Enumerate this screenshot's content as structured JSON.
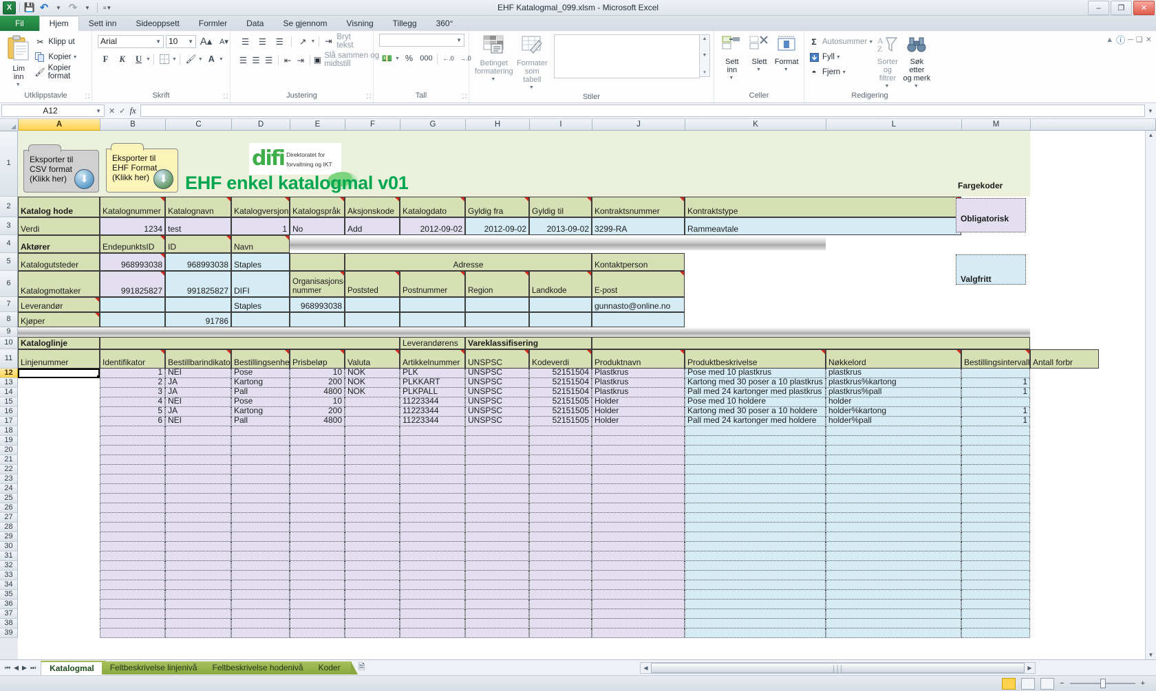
{
  "window": {
    "title": "EHF Katalogmal_099.xlsm  -  Microsoft Excel",
    "minimize": "–",
    "maximize": "❐",
    "close": "✕",
    "qat": {
      "excel": "X",
      "save": "save-icon",
      "undo": "undo-icon",
      "redo": "redo-icon",
      "customize": "customize-icon"
    }
  },
  "ribbon": {
    "tabs": [
      {
        "label": "Fil",
        "type": "file"
      },
      {
        "label": "Hjem",
        "type": "active"
      },
      {
        "label": "Sett inn",
        "type": "normal"
      },
      {
        "label": "Sideoppsett",
        "type": "normal"
      },
      {
        "label": "Formler",
        "type": "normal"
      },
      {
        "label": "Data",
        "type": "normal"
      },
      {
        "label": "Se gjennom",
        "type": "normal"
      },
      {
        "label": "Visning",
        "type": "normal"
      },
      {
        "label": "Tillegg",
        "type": "normal"
      },
      {
        "label": "360°",
        "type": "normal"
      }
    ],
    "groups": {
      "clipboard": {
        "name": "Utklippstavle",
        "paste": "Lim\ninn",
        "cut": "Klipp ut",
        "copy": "Kopier",
        "format_painter": "Kopier format"
      },
      "font": {
        "name": "Skrift",
        "font_name": "Arial",
        "font_size": "10",
        "grow": "A",
        "shrink": "A",
        "bold": "F",
        "italic": "K",
        "underline": "U",
        "borders": "borders-icon",
        "fill": "fill-color-icon",
        "fontcolor": "A"
      },
      "alignment": {
        "name": "Justering",
        "wrap": "Bryt tekst",
        "merge": "Slå sammen og midtstill",
        "orientation": "orientation-icon",
        "indent_dec": "decrease-indent-icon",
        "indent_inc": "increase-indent-icon"
      },
      "number": {
        "name": "Tall",
        "format_value": "",
        "currency": "currency-icon",
        "percent": "%",
        "comma": "000",
        "dec_inc": "increase-decimal-icon",
        "dec_dec": "decrease-decimal-icon"
      },
      "styles": {
        "name": "Stiler",
        "conditional": "Betinget\nformatering",
        "as_table": "Formater\nsom tabell"
      },
      "cells": {
        "name": "Celler",
        "insert": "Sett\ninn",
        "delete": "Slett",
        "format": "Format"
      },
      "editing": {
        "name": "Redigering",
        "autosum": "Autosummer",
        "fill": "Fyll",
        "clear": "Fjern",
        "sort_filter": "Sorter og\nfiltrer",
        "find_select": "Søk etter\nog merk"
      }
    }
  },
  "formula_bar": {
    "name_box": "A12",
    "formula": "",
    "fx": "fx"
  },
  "grid": {
    "columns": [
      "A",
      "B",
      "C",
      "D",
      "E",
      "F",
      "G",
      "H",
      "I",
      "J",
      "K",
      "L",
      "M"
    ],
    "selected_column": "A",
    "selected_row": "12",
    "rows": [
      "1",
      "2",
      "3",
      "4",
      "5",
      "6",
      "7",
      "8",
      "9",
      "10",
      "11",
      "12",
      "13",
      "14",
      "15",
      "16",
      "17",
      "18",
      "19",
      "20",
      "21",
      "22",
      "23",
      "24",
      "25",
      "26",
      "27",
      "28",
      "29",
      "30",
      "31",
      "32",
      "33",
      "34",
      "35",
      "36",
      "37",
      "38",
      "39"
    ],
    "sheet_title": "EHF enkel katalogmal v01",
    "logo": {
      "word": "difi",
      "sub_line1": "Direktoratet for",
      "sub_line2": "forvaltning og IKT"
    },
    "buttons": [
      {
        "label": "Eksporter til\nCSV format\n(Klikk her)",
        "color": "#d0d0d0"
      },
      {
        "label": "Eksporter til\nEHF Format\n(Klikk her)",
        "color": "#fbf4b8"
      }
    ],
    "legend": {
      "title": "Fargekoder",
      "mandatory": "Obligatorisk",
      "optional": "Valgfritt",
      "mandatory_color": "#e4dff0",
      "optional_color": "#d6ecf4"
    },
    "section_katalog_hode": {
      "label": "Katalog hode",
      "headers": [
        "Katalognummer",
        "Katalognavn",
        "Katalogversjon",
        "Katalogspråk",
        "Aksjonskode",
        "Katalogdato",
        "Gyldig fra",
        "Gyldig til",
        "Kontraktsnummer",
        "Kontraktstype"
      ],
      "row_label": "Verdi",
      "values": [
        "1234",
        "test",
        "1",
        "No",
        "Add",
        "2012-09-02",
        "2012-09-02",
        "2013-09-02",
        "3299-RA",
        "Rammeavtale"
      ]
    },
    "section_aktorer": {
      "label": "Aktører",
      "headers": [
        "EndepunktsID",
        "ID",
        "Navn"
      ],
      "adresse_label": "Adresse",
      "kontaktperson_label": "Kontaktperson",
      "sub_headers": [
        "Organisasjons-\nnummer",
        "Poststed",
        "Postnummer",
        "Region",
        "Landkode",
        "E-post"
      ],
      "rows": [
        {
          "label": "Katalogutsteder",
          "endepunkt": "968993038",
          "id": "968993038",
          "navn": "Staples",
          "orgnr": "",
          "poststed": "",
          "postnummer": "",
          "region": "",
          "landkode": "",
          "epost": ""
        },
        {
          "label": "Katalogmottaker",
          "endepunkt": "991825827",
          "id": "991825827",
          "navn": "DIFI",
          "orgnr": "",
          "poststed": "",
          "postnummer": "",
          "region": "",
          "landkode": "",
          "epost": ""
        },
        {
          "label": "Leverandør",
          "endepunkt": "",
          "id": "",
          "navn": "Staples",
          "orgnr": "968993038",
          "poststed": "",
          "postnummer": "",
          "region": "",
          "landkode": "",
          "epost": "gunnasto@online.no"
        },
        {
          "label": "Kjøper",
          "endepunkt": "",
          "id": "91786",
          "navn": "",
          "orgnr": "",
          "poststed": "",
          "postnummer": "",
          "region": "",
          "landkode": "",
          "epost": ""
        }
      ]
    },
    "section_kataloglinje": {
      "label": "Kataloglinje",
      "group_leverandor": "Leverandørens",
      "group_vareklass": "Vareklassifisering",
      "headers": [
        "Linjenummer",
        "Identifikator",
        "Bestillbarindikator",
        "Bestillingsenhet",
        "Prisbeløp",
        "Valuta",
        "Artikkelnummer",
        "UNSPSC",
        "Kodeverdi",
        "Produktnavn",
        "Produktbeskrivelse",
        "Nøkkelord",
        "Bestillingsintervall",
        "Antall forbr"
      ],
      "rows": [
        {
          "linje": "",
          "ident": "1",
          "bestillbar": "NEI",
          "enhet": "Pose",
          "pris": "10",
          "valuta": "NOK",
          "artikkel": "PLK",
          "unspsc": "UNSPSC",
          "kodeverdi": "52151504",
          "produktnavn": "Plastkrus",
          "beskrivelse": "Pose med 10 plastkrus",
          "nokkelord": "plastkrus",
          "intervall": ""
        },
        {
          "linje": "",
          "ident": "2",
          "bestillbar": "JA",
          "enhet": "Kartong",
          "pris": "200",
          "valuta": "NOK",
          "artikkel": "PLKKART",
          "unspsc": "UNSPSC",
          "kodeverdi": "52151504",
          "produktnavn": "Plastkrus",
          "beskrivelse": "Kartong med 30 poser a 10 plastkrus",
          "nokkelord": "plastkrus%kartong",
          "intervall": "1"
        },
        {
          "linje": "",
          "ident": "3",
          "bestillbar": "JA",
          "enhet": "Pall",
          "pris": "4800",
          "valuta": "NOK",
          "artikkel": "PLKPALL",
          "unspsc": "UNSPSC",
          "kodeverdi": "52151504",
          "produktnavn": "Plastkrus",
          "beskrivelse": "Pall med 24 kartonger med plastkrus",
          "nokkelord": "plastkrus%pall",
          "intervall": "1"
        },
        {
          "linje": "",
          "ident": "4",
          "bestillbar": "NEI",
          "enhet": "Pose",
          "pris": "10",
          "valuta": "",
          "artikkel": "11223344",
          "unspsc": "UNSPSC",
          "kodeverdi": "52151505",
          "produktnavn": "Holder",
          "beskrivelse": "Pose med 10 holdere",
          "nokkelord": "holder",
          "intervall": ""
        },
        {
          "linje": "",
          "ident": "5",
          "bestillbar": "JA",
          "enhet": "Kartong",
          "pris": "200",
          "valuta": "",
          "artikkel": "11223344",
          "unspsc": "UNSPSC",
          "kodeverdi": "52151505",
          "produktnavn": "Holder",
          "beskrivelse": "Kartong med 30 poser a 10 holdere",
          "nokkelord": "holder%kartong",
          "intervall": "1"
        },
        {
          "linje": "",
          "ident": "6",
          "bestillbar": "NEI",
          "enhet": "Pall",
          "pris": "4800",
          "valuta": "",
          "artikkel": "11223344",
          "unspsc": "UNSPSC",
          "kodeverdi": "52151505",
          "produktnavn": "Holder",
          "beskrivelse": "Pall med 24 kartonger med holdere",
          "nokkelord": "holder%pall",
          "intervall": "1"
        }
      ]
    }
  },
  "sheet_tabs": {
    "nav_first": "⏮",
    "nav_prev": "◀",
    "nav_next": "▶",
    "nav_last": "⏭",
    "tabs": [
      {
        "label": "Katalogmal",
        "active": true
      },
      {
        "label": "Feltbeskrivelse linjenivå",
        "active": false
      },
      {
        "label": "Feltbeskrivelse hodenivå",
        "active": false
      },
      {
        "label": "Koder",
        "active": false
      }
    ],
    "new_sheet": "new-sheet-icon"
  },
  "status_bar": {
    "zoom": "",
    "ready": ""
  }
}
